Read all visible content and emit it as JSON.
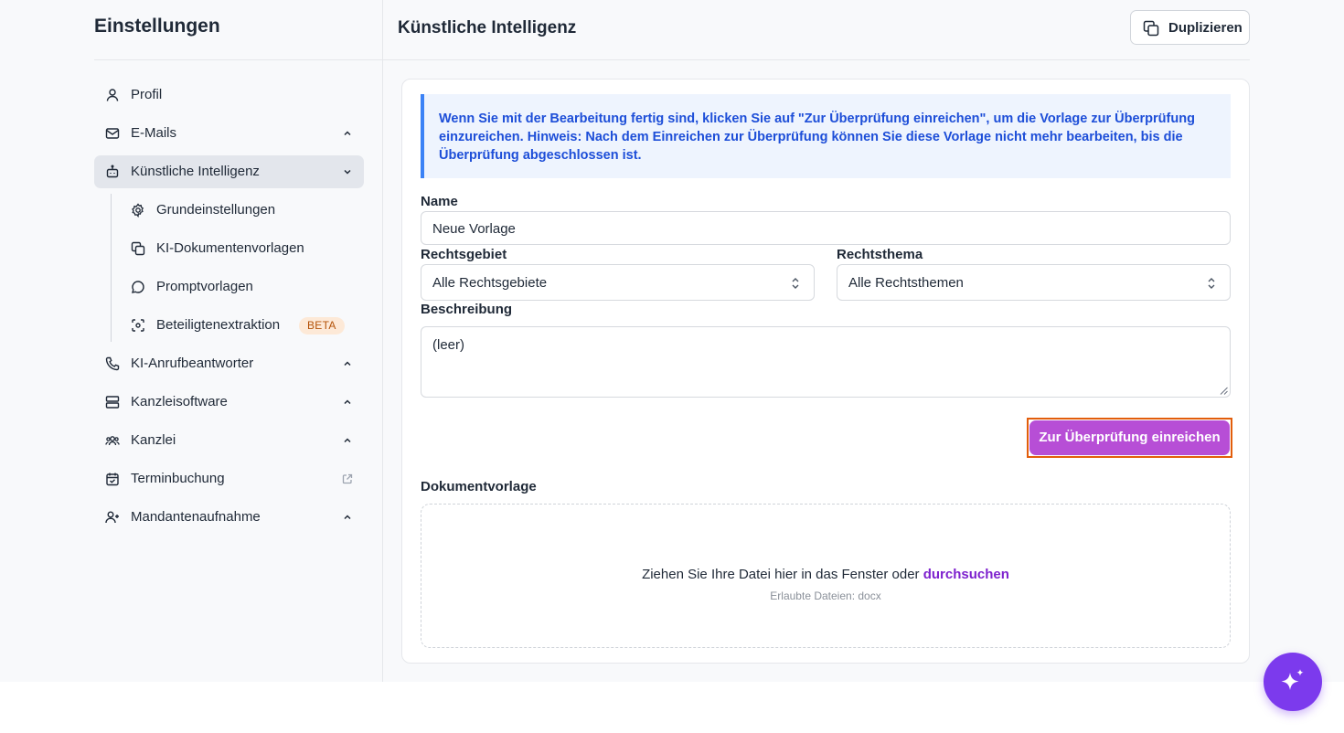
{
  "sidebar": {
    "title": "Einstellungen",
    "items": [
      {
        "label": "Profil",
        "icon": "user-icon"
      },
      {
        "label": "E-Mails",
        "icon": "mail-icon",
        "expanded": false
      },
      {
        "label": "Künstliche Intelligenz",
        "icon": "bot-icon",
        "expanded": true,
        "active": true
      },
      {
        "label": "KI-Anrufbeantworter",
        "icon": "phone-icon",
        "expanded": false
      },
      {
        "label": "Kanzleisoftware",
        "icon": "server-icon",
        "expanded": false
      },
      {
        "label": "Kanzlei",
        "icon": "users-icon",
        "expanded": false
      },
      {
        "label": "Terminbuchung",
        "icon": "calendar-check-icon",
        "external": true
      },
      {
        "label": "Mandantenaufnahme",
        "icon": "user-plus-icon",
        "expanded": false
      }
    ],
    "sub_items": [
      {
        "label": "Grundeinstellungen",
        "icon": "gear-icon"
      },
      {
        "label": "KI-Dokumentenvorlagen",
        "icon": "copy-icon"
      },
      {
        "label": "Promptvorlagen",
        "icon": "chat-bubble-icon"
      },
      {
        "label": "Beteiligtenextraktion",
        "icon": "scan-icon",
        "badge": "BETA"
      }
    ]
  },
  "header": {
    "title": "Künstliche Intelligenz",
    "duplicate_label": "Duplizieren"
  },
  "form": {
    "info_text_1": "Wenn Sie mit der Bearbeitung fertig sind, klicken Sie auf \"Zur Überprüfung einreichen\", um die Vorlage zur Überprüfung einzureichen. ",
    "info_hint": "Hinweis:",
    "info_text_2": " Nach dem Einreichen zur Überprüfung können Sie diese Vorlage nicht mehr bearbeiten, bis die Überprüfung abgeschlossen ist.",
    "name_label": "Name",
    "name_value": "Neue Vorlage",
    "rechtsgebiet_label": "Rechtsgebiet",
    "rechtsgebiet_value": "Alle Rechtsgebiete",
    "rechtsthema_label": "Rechtsthema",
    "rechtsthema_value": "Alle Rechtsthemen",
    "beschreibung_label": "Beschreibung",
    "beschreibung_value": "(leer)",
    "submit_label": "Zur Überprüfung einreichen",
    "dokumentvorlage_label": "Dokumentvorlage",
    "drop_text": "Ziehen Sie Ihre Datei hier in das Fenster oder ",
    "drop_link": "durchsuchen",
    "drop_hint": "Erlaubte Dateien: docx"
  },
  "colors": {
    "accent": "#7c3aed",
    "submit": "#b74ed6",
    "info_border": "#3b82f6",
    "info_text": "#1d4ed8"
  },
  "fab": {
    "icon": "sparkles-icon"
  }
}
